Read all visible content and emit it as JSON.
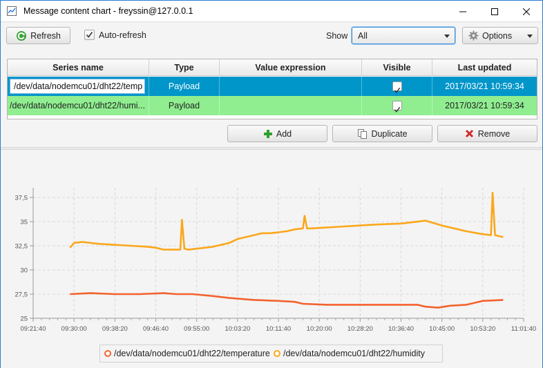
{
  "window": {
    "title": "Message content chart - freyssin@127.0.0.1"
  },
  "toolbar": {
    "refresh_label": "Refresh",
    "auto_refresh_label": "Auto-refresh",
    "auto_refresh_checked": true,
    "show_label": "Show",
    "show_value": "All",
    "options_label": "Options"
  },
  "table": {
    "columns": [
      "Series name",
      "Type",
      "Value expression",
      "Visible",
      "Last updated"
    ],
    "rows": [
      {
        "series_name": "/dev/data/nodemcu01/dht22/temp",
        "type": "Payload",
        "value_expression": "",
        "visible": true,
        "last_updated": "2017/03/21 10:59:34",
        "selected": true
      },
      {
        "series_name": "/dev/data/nodemcu01/dht22/humi...",
        "type": "Payload",
        "value_expression": "",
        "visible": true,
        "last_updated": "2017/03/21 10:59:34",
        "selected": false
      }
    ]
  },
  "actions": {
    "add_label": "Add",
    "duplicate_label": "Duplicate",
    "remove_label": "Remove"
  },
  "colors": {
    "selected_row": "#0096c9",
    "second_row": "#90ee90",
    "temperature": "#f3622d",
    "humidity": "#fba71b",
    "accent": "#2b79d8"
  },
  "chart_data": {
    "type": "line",
    "x_ticks": [
      "09:21:40",
      "09:30:00",
      "09:38:20",
      "09:46:40",
      "09:55:00",
      "10:03:20",
      "10:11:40",
      "10:20:00",
      "10:28:20",
      "10:36:40",
      "10:45:00",
      "10:53:20",
      "11:01:40"
    ],
    "y_ticks": [
      "25",
      "27,5",
      "30",
      "32,5",
      "35",
      "37,5"
    ],
    "xlim_seconds_from_first_tick": [
      0,
      6000
    ],
    "ylim": [
      25,
      38.5
    ],
    "grid": true,
    "legend": "bottom",
    "series": [
      {
        "name": "/dev/data/nodemcu01/dht22/temperature",
        "x_seconds_from_first_tick": [
          450,
          700,
          1000,
          1300,
          1600,
          1750,
          1950,
          2200,
          2400,
          2700,
          3000,
          3200,
          3300,
          3600,
          3900,
          4200,
          4500,
          4700,
          4800,
          4950,
          5100,
          5300,
          5400,
          5500,
          5750
        ],
        "values": [
          27.5,
          27.6,
          27.5,
          27.5,
          27.6,
          27.5,
          27.5,
          27.3,
          27.1,
          26.9,
          26.8,
          26.7,
          26.5,
          26.4,
          26.4,
          26.4,
          26.4,
          26.4,
          26.2,
          26.1,
          26.3,
          26.4,
          26.6,
          26.8,
          26.9
        ]
      },
      {
        "name": "/dev/data/nodemcu01/dht22/humidity",
        "x_seconds_from_first_tick": [
          450,
          500,
          600,
          700,
          800,
          1000,
          1200,
          1400,
          1500,
          1600,
          1700,
          1800,
          1820,
          1850,
          1900,
          2000,
          2200,
          2400,
          2500,
          2600,
          2700,
          2800,
          2900,
          3000,
          3100,
          3200,
          3300,
          3320,
          3350,
          3400,
          3600,
          3800,
          4000,
          4200,
          4500,
          4800,
          5000,
          5200,
          5300,
          5500,
          5600,
          5620,
          5650,
          5700,
          5750
        ],
        "values": [
          32.3,
          32.8,
          32.9,
          32.8,
          32.7,
          32.6,
          32.5,
          32.4,
          32.3,
          32.1,
          32.1,
          32.1,
          35.2,
          32.2,
          32.1,
          32.2,
          32.4,
          32.8,
          33.2,
          33.4,
          33.6,
          33.8,
          33.8,
          33.9,
          34.0,
          34.2,
          34.3,
          35.6,
          34.3,
          34.3,
          34.4,
          34.5,
          34.6,
          34.7,
          34.8,
          35.1,
          34.6,
          34.2,
          34.0,
          33.7,
          33.6,
          38.0,
          33.6,
          33.5,
          33.4
        ]
      }
    ]
  }
}
